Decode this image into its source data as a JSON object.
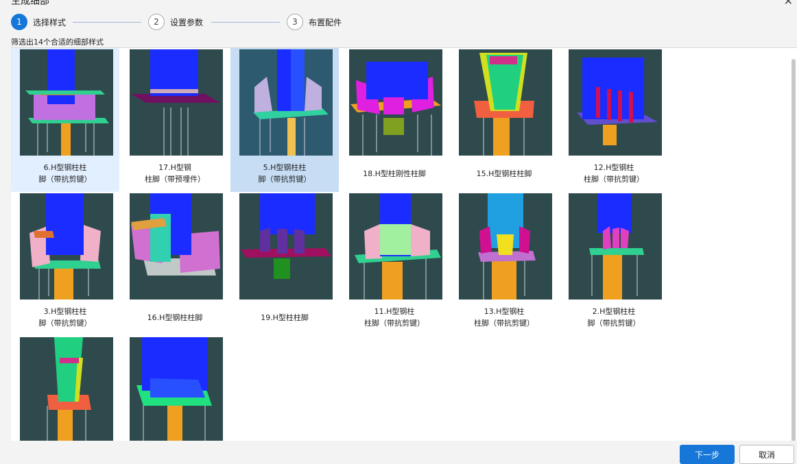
{
  "window": {
    "title": "生成细部"
  },
  "steps": [
    {
      "number": "1",
      "label": "选择样式"
    },
    {
      "number": "2",
      "label": "设置参数"
    },
    {
      "number": "3",
      "label": "布置配件"
    }
  ],
  "filter_text": "筛选出14个合适的细部样式",
  "items": [
    {
      "label": "6.H型钢柱柱\n脚（带抗剪键）",
      "icon": "column-base-6"
    },
    {
      "label": "17.H型钢\n柱脚（带预埋件）",
      "icon": "column-base-17"
    },
    {
      "label": "5.H型钢柱柱\n脚（带抗剪键）",
      "icon": "column-base-5"
    },
    {
      "label": "18.H型柱刚性柱脚",
      "icon": "column-base-18"
    },
    {
      "label": "15.H型钢柱柱脚",
      "icon": "column-base-15"
    },
    {
      "label": "12.H型钢柱\n柱脚（带抗剪键）",
      "icon": "column-base-12"
    },
    {
      "label": "3.H型钢柱柱\n脚（带抗剪键）",
      "icon": "column-base-3"
    },
    {
      "label": "16.H型钢柱柱脚",
      "icon": "column-base-16"
    },
    {
      "label": "19.H型柱柱脚",
      "icon": "column-base-19"
    },
    {
      "label": "11.H型钢柱\n柱脚（带抗剪键）",
      "icon": "column-base-11"
    },
    {
      "label": "13.H型钢柱\n柱脚（带抗剪键）",
      "icon": "column-base-13"
    },
    {
      "label": "2.H型钢柱柱\n脚（带抗剪键）",
      "icon": "column-base-2"
    },
    {
      "label": "",
      "icon": "column-base-inclined"
    },
    {
      "label": "",
      "icon": "column-base-stiffened"
    }
  ],
  "buttons": {
    "next": "下一步",
    "cancel": "取消"
  },
  "colors": {
    "accent": "#1677d9",
    "thumb_bg": "#2e4a4c",
    "selected": "#c6ddf3",
    "hover": "#e2efff"
  }
}
